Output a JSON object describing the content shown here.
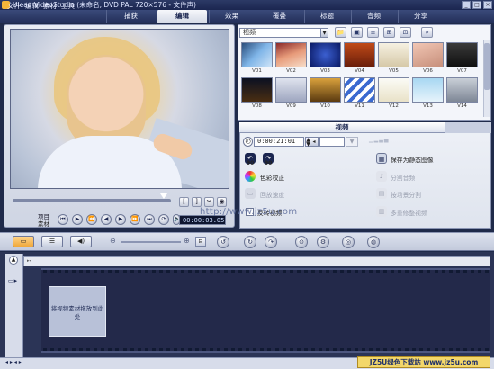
{
  "titlebar": {
    "title": "Ulead VideoStudio (未命名, DVD PAL 720×576 - 文件声)"
  },
  "menu": {
    "items": [
      "文件",
      "编辑",
      "素材",
      "工具"
    ]
  },
  "steps": {
    "tabs": [
      "捕获",
      "编辑",
      "效果",
      "覆叠",
      "标题",
      "音频",
      "分享"
    ],
    "active": "编辑"
  },
  "preview": {
    "mode_label": "项目",
    "mode_label2": "素材",
    "timecode": "00:00:03.05",
    "transport": [
      "⏮",
      "▶",
      "⏪",
      "◀",
      "▶",
      "⏩",
      "⏭",
      "⟳",
      "🔈"
    ],
    "trim_buttons": [
      "[",
      "]",
      "✂",
      "◉"
    ]
  },
  "library": {
    "folder": "视频",
    "thumb_labels": [
      "V01",
      "V02",
      "V03",
      "V04",
      "V05",
      "V06",
      "V07",
      "V08",
      "V09",
      "V10",
      "V11",
      "V12",
      "V13",
      "V14"
    ]
  },
  "options": {
    "tab_label": "视频",
    "duration": "0:00:21:01",
    "volume": "",
    "rotate_left": "90",
    "rotate_right": "90",
    "color_correction": "色彩校正",
    "playback_speed": "回放速度",
    "reverse_video": "反转视频",
    "save_still": "保存为静态图像",
    "split_audio": "分割音频",
    "split_by_scene": "按场景分割",
    "multi_trim": "多重修整视频"
  },
  "timeline": {
    "placeholder": "将视频素材拖放到此处"
  },
  "watermark": "http://www.jz5u.com",
  "footer_watermark": "JZ5U绿色下载站 www.jz5u.com"
}
